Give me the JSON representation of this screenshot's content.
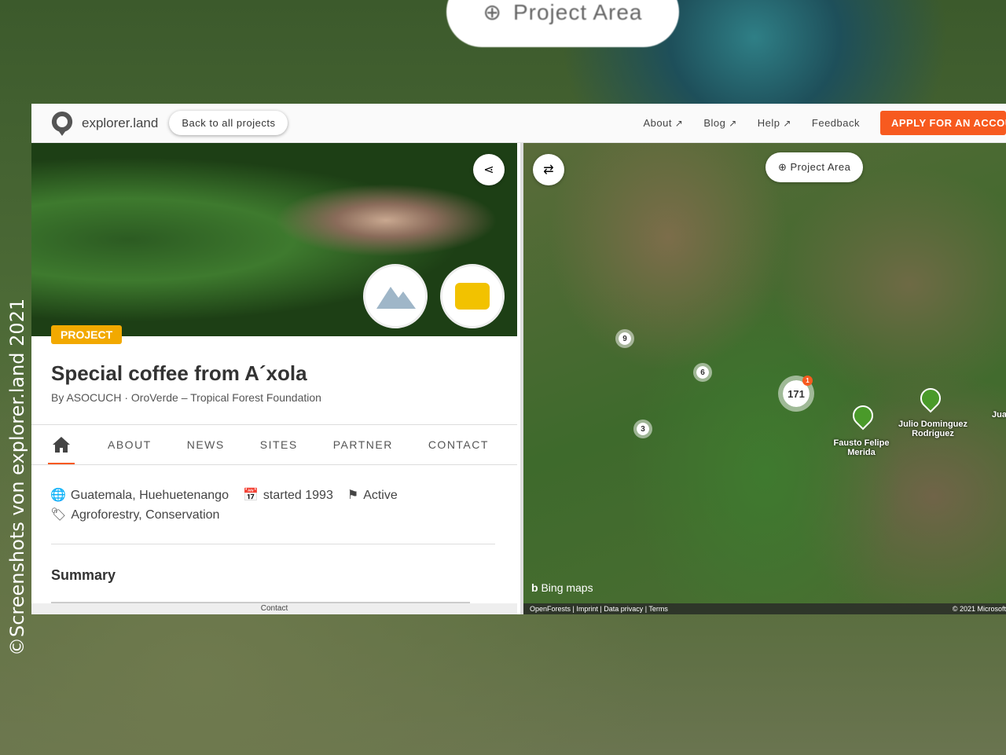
{
  "background": {
    "project_area_label": "Project Area",
    "watermark": "©Screenshots von explorer.land 2021"
  },
  "header": {
    "brand": "explorer.land",
    "back_label": "Back to all projects",
    "nav": [
      "About",
      "Blog",
      "Help",
      "Feedback"
    ],
    "apply_label": "APPLY FOR AN ACCOUNT",
    "accent": "#f75a1f"
  },
  "project": {
    "badge": "PROJECT",
    "badge_color": "#f2a900",
    "title": "Special coffee from A´xola",
    "by": "By ASOCUCH · OroVerde – Tropical Forest Foundation",
    "tabs": [
      "ABOUT",
      "NEWS",
      "SITES",
      "PARTNER",
      "CONTACT"
    ],
    "location": "Guatemala, Huehuetenango",
    "started": "started 1993",
    "status": "Active",
    "tags": "Agroforestry, Conservation",
    "summary_heading": "Summary",
    "footer_contact": "Contact"
  },
  "map": {
    "project_area_label": "Project Area",
    "clusters": [
      "9",
      "6",
      "3",
      "171"
    ],
    "cluster_badge": "1",
    "sites": [
      "Fausto Felipe Merida",
      "Julio Dominguez Rodriguez",
      "Jua"
    ],
    "bing_label": "Bing maps",
    "footer_links": "OpenForests | Imprint | Data privacy | Terms",
    "copyright": "© 2021 Microsoft"
  }
}
